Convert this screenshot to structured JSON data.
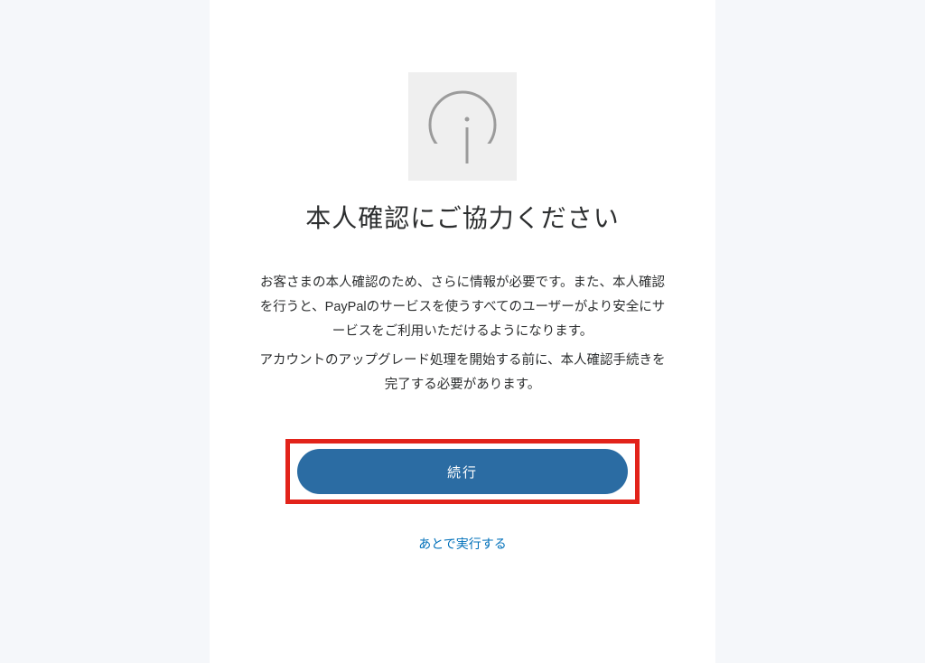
{
  "heading": "本人確認にご協力ください",
  "paragraph1": "お客さまの本人確認のため、さらに情報が必要です。また、本人確認を行うと、PayPalのサービスを使うすべてのユーザーがより安全にサービスをご利用いただけるようになります。",
  "paragraph2": "アカウントのアップグレード処理を開始する前に、本人確認手続きを完了する必要があります。",
  "continue_label": "続行",
  "later_label": "あとで実行する",
  "colors": {
    "page_bg": "#f5f7fa",
    "card_bg": "#ffffff",
    "primary_button": "#2b6ca3",
    "highlight_border": "#e2231a",
    "link": "#0070ba",
    "icon_bg": "#efefef",
    "icon_stroke": "#9b9b9b"
  }
}
